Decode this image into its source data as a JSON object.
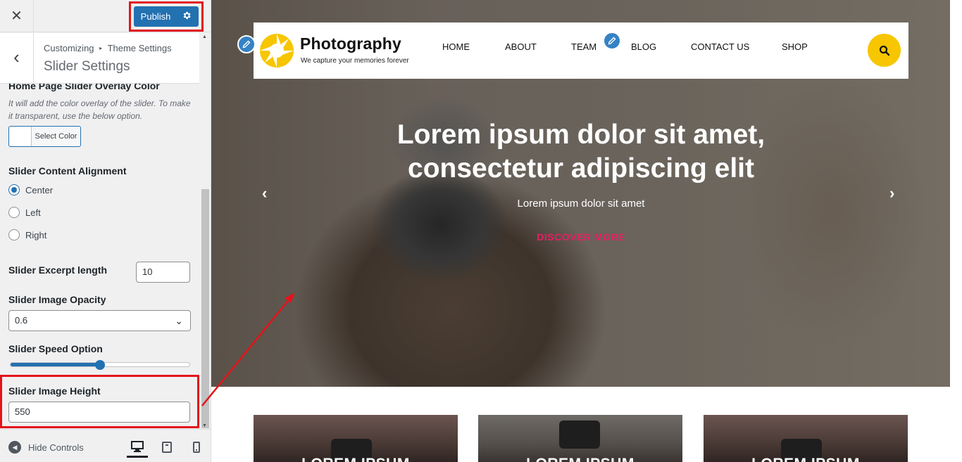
{
  "customizer": {
    "close_icon": "close-icon",
    "publish_label": "Publish",
    "breadcrumb_parent": "Customizing",
    "breadcrumb_section": "Theme Settings",
    "section_title": "Slider Settings",
    "overlay_color": {
      "title": "Home Page Slider Overlay Color",
      "description": "It will add the color overlay of the slider. To make it transparent, use the below option.",
      "button_label": "Select Color"
    },
    "content_alignment": {
      "title": "Slider Content Alignment",
      "options": [
        "Center",
        "Left",
        "Right"
      ],
      "selected": "Center"
    },
    "excerpt_length": {
      "title": "Slider Excerpt length",
      "value": "10"
    },
    "image_opacity": {
      "title": "Slider Image Opacity",
      "value": "0.6"
    },
    "speed_option": {
      "title": "Slider Speed Option",
      "fraction": 0.5
    },
    "image_height": {
      "title": "Slider Image Height",
      "value": "550"
    },
    "footer": {
      "hide_controls_label": "Hide Controls",
      "devices": [
        "desktop-icon",
        "tablet-icon",
        "mobile-icon"
      ],
      "active_device": "desktop-icon"
    }
  },
  "preview": {
    "site_title": "Photography",
    "site_tagline": "We capture your memories forever",
    "nav": [
      "HOME",
      "ABOUT",
      "TEAM",
      "BLOG",
      "CONTACT US",
      "SHOP"
    ],
    "slider": {
      "heading_line1": "Lorem ipsum dolor sit amet,",
      "heading_line2": "consectetur adipiscing elit",
      "subtitle": "Lorem ipsum dolor sit amet",
      "cta": "DISCOVER MORE"
    },
    "cards": [
      {
        "title": "LOREM IPSUM"
      },
      {
        "title": "LOREM IPSUM"
      },
      {
        "title": "LOREM IPSUM"
      }
    ]
  },
  "colors": {
    "publish": "#2271b1",
    "highlight": "#e3141a",
    "accent_yellow": "#f7c600",
    "cta_pink": "#e91e63"
  }
}
